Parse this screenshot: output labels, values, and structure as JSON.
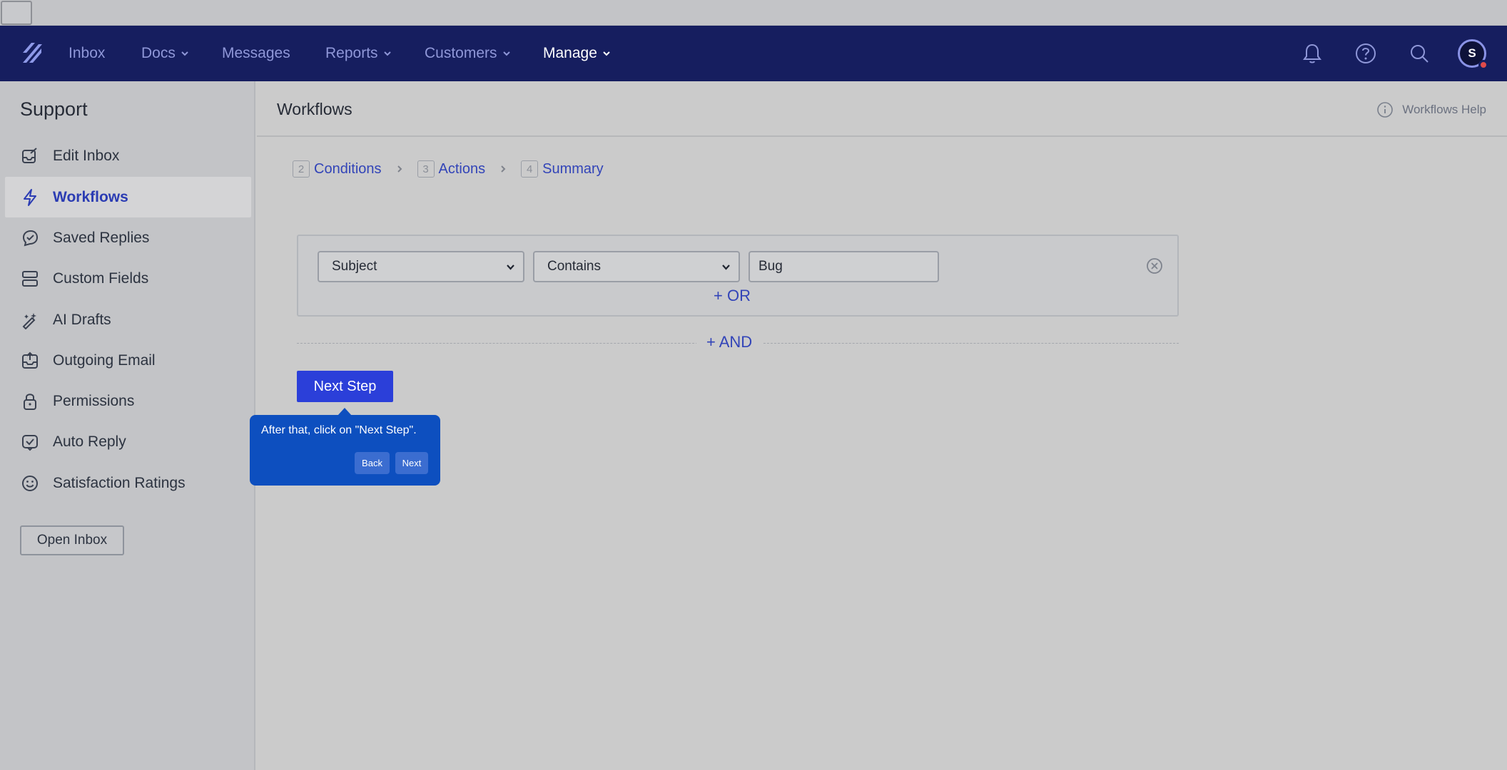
{
  "nav": {
    "items": [
      {
        "label": "Inbox"
      },
      {
        "label": "Docs"
      },
      {
        "label": "Messages"
      },
      {
        "label": "Reports"
      },
      {
        "label": "Customers"
      },
      {
        "label": "Manage"
      }
    ],
    "active": "Manage",
    "avatar_initial": "S",
    "icons": [
      "bell-icon",
      "help-icon",
      "search-icon"
    ]
  },
  "sidebar": {
    "title": "Support",
    "items": [
      {
        "label": "Edit Inbox",
        "icon": "edit-inbox-icon"
      },
      {
        "label": "Workflows",
        "icon": "lightning-icon",
        "active": true
      },
      {
        "label": "Saved Replies",
        "icon": "saved-replies-icon"
      },
      {
        "label": "Custom Fields",
        "icon": "custom-fields-icon"
      },
      {
        "label": "AI Drafts",
        "icon": "ai-drafts-icon"
      },
      {
        "label": "Outgoing Email",
        "icon": "outgoing-email-icon"
      },
      {
        "label": "Permissions",
        "icon": "lock-icon"
      },
      {
        "label": "Auto Reply",
        "icon": "auto-reply-icon"
      },
      {
        "label": "Satisfaction Ratings",
        "icon": "smiley-icon"
      }
    ],
    "open_inbox_label": "Open Inbox"
  },
  "main": {
    "title": "Workflows",
    "help_label": "Workflows Help",
    "steps": [
      {
        "num": "2",
        "label": "Conditions"
      },
      {
        "num": "3",
        "label": "Actions"
      },
      {
        "num": "4",
        "label": "Summary"
      }
    ],
    "condition": {
      "field": "Subject",
      "operator": "Contains",
      "value": "Bug"
    },
    "or_label": "+ OR",
    "and_label": "+ AND",
    "next_step_label": "Next Step"
  },
  "tooltip": {
    "text": "After that, click on \"Next Step\".",
    "back_label": "Back",
    "next_label": "Next",
    "color": "#0d4fbf"
  },
  "colors": {
    "navbar": "#161e5f",
    "accent": "#2b3fd9",
    "link": "#3244b8"
  }
}
